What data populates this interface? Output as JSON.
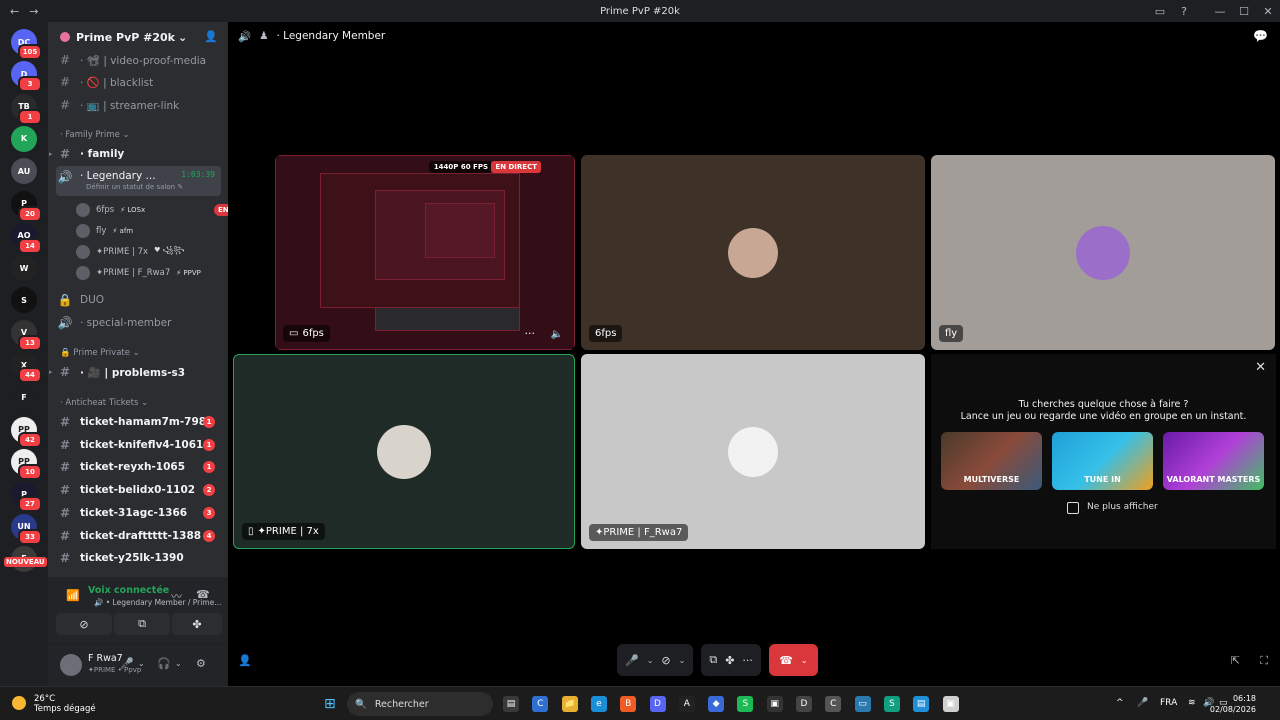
{
  "window": {
    "title": "Prime PvP #20k",
    "back_icon": "←",
    "forward_icon": "→",
    "inbox_icon": "▭",
    "help_icon": "?",
    "minimize": "—",
    "maximize": "☐",
    "close": "✕"
  },
  "servers": [
    {
      "label": "DC",
      "badge": "105",
      "color": "#5865f2"
    },
    {
      "label": "D",
      "badge": "3",
      "color": "#5865f2"
    },
    {
      "label": "TB",
      "badge": "1",
      "color": "#2a2a2a"
    },
    {
      "label": "K",
      "badge": "",
      "color": "#23a559"
    },
    {
      "label": "AU",
      "badge": "",
      "color": "#4a4d55"
    },
    {
      "label": "P",
      "badge": "20",
      "color": "#111111"
    },
    {
      "label": "AO",
      "badge": "14",
      "color": "#1a1a2e"
    },
    {
      "label": "W",
      "badge": "",
      "color": "#222222"
    },
    {
      "label": "S",
      "badge": "",
      "color": "#111111"
    },
    {
      "label": "V",
      "badge": "13",
      "color": "#333333"
    },
    {
      "label": "X",
      "badge": "44",
      "color": "#222222"
    },
    {
      "label": "F",
      "badge": "",
      "color": "#1e1f22"
    },
    {
      "label": "PP",
      "badge": "42",
      "color": "#eeeeee"
    },
    {
      "label": "PP",
      "badge": "10",
      "color": "#eeeeee"
    },
    {
      "label": "P",
      "badge": "27",
      "color": "#1a1a2e"
    },
    {
      "label": "UN",
      "badge": "33",
      "color": "#2a3a8a"
    },
    {
      "label": "E",
      "badge": "",
      "color": "#3a3a3a"
    }
  ],
  "new_badge": "NOUVEAU",
  "sidebar": {
    "server_name": "Prime PvP #20k",
    "chevron": "⌄",
    "invite_icon": "👤",
    "channels_top": [
      {
        "icon": "#",
        "label": "· 📽 | video-proof-media"
      },
      {
        "icon": "#",
        "label": "· 🚫 | blacklist"
      },
      {
        "icon": "#",
        "label": "· 📺 | streamer-link"
      }
    ],
    "cat_family": "· Family Prime ⌄",
    "family_channel": "· family",
    "legendary": {
      "label": "· Legendary ...",
      "time": "1:03:39",
      "sub": "Définir un statut de salon ✎"
    },
    "voice_users": [
      {
        "name": "6fps",
        "tag": "⚡ LOSx",
        "live": "EN DIRECT"
      },
      {
        "name": "fly",
        "tag": "⚡ afm",
        "live": ""
      },
      {
        "name": "✦PRIME | 7x",
        "tag": "♥ ꧁꧂",
        "live": ""
      },
      {
        "name": "✦PRIME | F_Rwa7",
        "tag": "⚡ PPVP",
        "live": ""
      }
    ],
    "duo": "DUO",
    "special": "· special-member",
    "cat_prime_private": "🔒 Prime Private ⌄",
    "problems": "· 🎥 | problems-s3",
    "cat_anticheat": "· Anticheat Tickets ⌄",
    "tickets": [
      {
        "label": "ticket-hamam7m-798",
        "unread": "1"
      },
      {
        "label": "ticket-knifeflv4-1061",
        "unread": "1"
      },
      {
        "label": "ticket-reyxh-1065",
        "unread": "1"
      },
      {
        "label": "ticket-belidx0-1102",
        "unread": "2"
      },
      {
        "label": "ticket-31agc-1366",
        "unread": "3"
      },
      {
        "label": "ticket-drafttttt-1388",
        "unread": "4"
      },
      {
        "label": "ticket-y25lk-1390",
        "unread": ""
      }
    ]
  },
  "voice_panel": {
    "status": "Voix connectée",
    "location": "🔊 • Legendary Member / Prime...",
    "signal_icon": "📶",
    "wave_icon": "〰",
    "disconnect_icon": "☎",
    "camera_off_icon": "⊘",
    "share_icon": "⧉",
    "activity_icon": "✤"
  },
  "user_panel": {
    "username": "F Rwa7",
    "status": "✦PRIME • Ppvp",
    "mic_icon": "🎤",
    "headset_icon": "🎧",
    "settings_icon": "⚙",
    "dropdown": "⌄"
  },
  "stage": {
    "speaker_icon": "🔊",
    "channel_name": "· Legendary Member",
    "chat_icon": "💬",
    "tiles": {
      "screen_label": "6fps",
      "screen_res": "1440P 60 FPS",
      "screen_live": "EN DIRECT",
      "more_icon": "···",
      "volume_icon": "🔈",
      "t2_label": "6fps",
      "t3_label": "fly",
      "t4_label": "✦PRIME | 7x",
      "t5_label": "✦PRIME | F_Rwa7"
    },
    "activity": {
      "close_icon": "✕",
      "line1": "Tu cherches quelque chose à faire ?",
      "line2": "Lance un jeu ou regarde une vidéo en groupe en un instant.",
      "games": [
        "MULTIVERSE",
        "TUNE IN",
        "VALORANT MASTERS"
      ],
      "checkbox_label": "Ne plus afficher"
    },
    "controls": {
      "mic_icon": "🎤",
      "dropdown": "⌄",
      "camera_icon": "⊘",
      "share_icon": "⧉",
      "activity_icon": "✤",
      "more_icon": "···",
      "hangup_icon": "☎"
    },
    "bottom_left_icon": "👤",
    "popout_icon": "⇱",
    "fullscreen_icon": "⛶"
  },
  "taskbar": {
    "temp": "26°C",
    "weather": "Temps dégagé",
    "start_icon": "⊞",
    "search_icon": "🔍",
    "search_label": "Rechercher",
    "apps": [
      "▤",
      "C",
      "📁",
      "e",
      "B",
      "D",
      "A",
      "◆",
      "S",
      "▣",
      "D",
      "C",
      "▭",
      "S",
      "▤",
      "▣"
    ],
    "tray_up": "^",
    "tray_mic": "🎤",
    "lang": "FRA",
    "wifi": "≋",
    "sound": "🔊",
    "battery": "▭",
    "time": "06:18",
    "date": "02/08/2026"
  }
}
